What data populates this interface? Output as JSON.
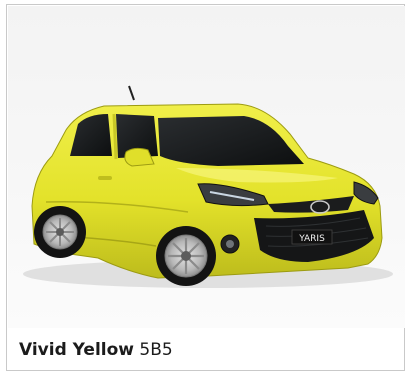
{
  "caption": {
    "color_name": "Vivid Yellow",
    "paint_code": "5B5"
  },
  "car": {
    "plate_text": "YARIS",
    "body_color": "#E6E62A",
    "body_shadow_color": "#B9B81C"
  }
}
